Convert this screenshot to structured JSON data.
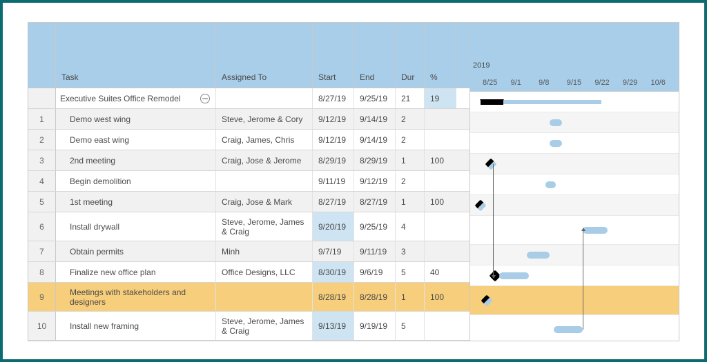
{
  "columns": {
    "task": "Task",
    "assigned": "Assigned To",
    "start": "Start",
    "end": "End",
    "dur": "Dur",
    "pct": "%"
  },
  "timeline": {
    "year": "2019",
    "weeks": [
      "8/25",
      "9/1",
      "9/8",
      "9/15",
      "9/22",
      "9/29",
      "10/6"
    ]
  },
  "rows": [
    {
      "num": "",
      "task": "Executive Suites Office Remodel",
      "assigned": "",
      "start": "8/27/19",
      "end": "9/25/19",
      "dur": "21",
      "pct": "19",
      "indent": 0,
      "collapse": true,
      "alt": false,
      "pctHl": true
    },
    {
      "num": "1",
      "task": "Demo west wing",
      "assigned": "Steve, Jerome & Cory",
      "start": "9/12/19",
      "end": "9/14/19",
      "dur": "2",
      "pct": "",
      "indent": 1,
      "alt": true
    },
    {
      "num": "2",
      "task": "Demo east wing",
      "assigned": "Craig, James, Chris",
      "start": "9/12/19",
      "end": "9/14/19",
      "dur": "2",
      "pct": "",
      "indent": 1,
      "alt": false
    },
    {
      "num": "3",
      "task": "2nd meeting",
      "assigned": "Craig, Jose & Jerome",
      "start": "8/29/19",
      "end": "8/29/19",
      "dur": "1",
      "pct": "100",
      "indent": 1,
      "alt": true
    },
    {
      "num": "4",
      "task": "Begin demolition",
      "assigned": "",
      "start": "9/11/19",
      "end": "9/12/19",
      "dur": "2",
      "pct": "",
      "indent": 1,
      "alt": false
    },
    {
      "num": "5",
      "task": "1st meeting",
      "assigned": "Craig, Jose & Mark",
      "start": "8/27/19",
      "end": "8/27/19",
      "dur": "1",
      "pct": "100",
      "indent": 1,
      "alt": true
    },
    {
      "num": "6",
      "task": "Install drywall",
      "assigned": "Steve, Jerome, James & Craig",
      "start": "9/20/19",
      "end": "9/25/19",
      "dur": "4",
      "pct": "",
      "indent": 1,
      "alt": false,
      "startHl": true,
      "tall": true
    },
    {
      "num": "7",
      "task": "Obtain permits",
      "assigned": "Minh",
      "start": "9/7/19",
      "end": "9/11/19",
      "dur": "3",
      "pct": "",
      "indent": 1,
      "alt": true
    },
    {
      "num": "8",
      "task": "Finalize new office plan",
      "assigned": "Office Designs, LLC",
      "start": "8/30/19",
      "end": "9/6/19",
      "dur": "5",
      "pct": "40",
      "indent": 1,
      "alt": false,
      "startHl": true
    },
    {
      "num": "9",
      "task": "Meetings with stakeholders and designers",
      "assigned": "",
      "start": "8/28/19",
      "end": "8/28/19",
      "dur": "1",
      "pct": "100",
      "indent": 1,
      "sel": true,
      "tall": true
    },
    {
      "num": "10",
      "task": "Install new framing",
      "assigned": "Steve, Jerome, James & Craig",
      "start": "9/13/19",
      "end": "9/19/19",
      "dur": "5",
      "pct": "",
      "indent": 1,
      "alt": false,
      "startHl": true,
      "tall": true
    }
  ],
  "chart_data": {
    "type": "gantt",
    "weekWidthPct": 14.2857,
    "origin": "2019-08-25",
    "bars": [
      {
        "row": 0,
        "kind": "summary",
        "leftPct": 5,
        "widthPct": 58,
        "progressPct": 19
      },
      {
        "row": 1,
        "kind": "bar",
        "leftPct": 38,
        "widthPct": 6
      },
      {
        "row": 2,
        "kind": "bar",
        "leftPct": 38,
        "widthPct": 6
      },
      {
        "row": 3,
        "kind": "milestone",
        "leftPct": 10
      },
      {
        "row": 4,
        "kind": "bar",
        "leftPct": 36,
        "widthPct": 5
      },
      {
        "row": 5,
        "kind": "milestone",
        "leftPct": 5
      },
      {
        "row": 6,
        "kind": "bar",
        "leftPct": 54,
        "widthPct": 12
      },
      {
        "row": 7,
        "kind": "bar",
        "leftPct": 27,
        "widthPct": 11
      },
      {
        "row": 8,
        "kind": "milestone-progress",
        "leftPct": 12,
        "widthPct": 14
      },
      {
        "row": 9,
        "kind": "milestone",
        "leftPct": 8
      },
      {
        "row": 10,
        "kind": "bar",
        "leftPct": 40,
        "widthPct": 14
      }
    ]
  }
}
